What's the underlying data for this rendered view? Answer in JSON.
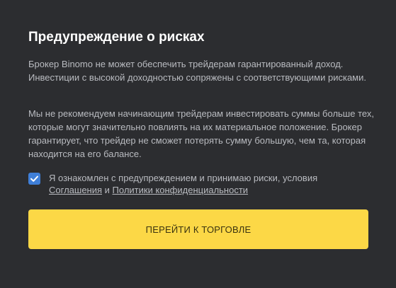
{
  "modal": {
    "title": "Предупреждение о рисках",
    "paragraph1": "Брокер Binomo не может обеспечить трейдерам гарантированный доход. Инвестиции с высокой доходностью сопряжены с соответствующими рисками.",
    "paragraph2": "Мы не рекомендуем начинающим трейдерам инвестировать суммы больше тех, которые могут значительно повлиять на их материальное положение. Брокер гарантирует, что трейдер не сможет потерять сумму большую, чем та, которая находится на его балансе.",
    "agreement": {
      "checked": true,
      "text_before": "Я ознакомлен с предупреждением и принимаю риски, условия ",
      "link_terms": "Соглашения",
      "text_and": " и ",
      "link_privacy": "Политики конфиденциальности"
    },
    "button_label": "ПЕРЕЙТИ К ТОРГОВЛЕ"
  },
  "colors": {
    "background": "#2c2d30",
    "accent_yellow": "#fcd846",
    "checkbox_blue": "#3f7fd8",
    "text_muted": "#b9bbc0",
    "title": "#ffffff"
  }
}
